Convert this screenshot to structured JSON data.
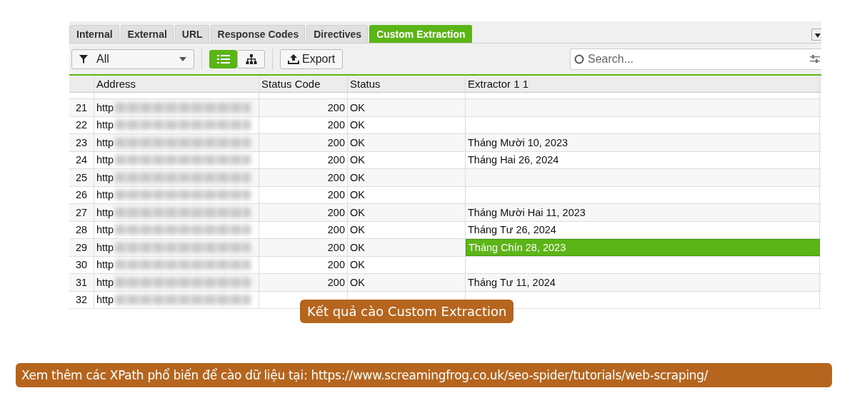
{
  "tabs": [
    {
      "label": "Internal",
      "selected": false
    },
    {
      "label": "External",
      "selected": false
    },
    {
      "label": "URL",
      "selected": false
    },
    {
      "label": "Response Codes",
      "selected": false
    },
    {
      "label": "Directives",
      "selected": false
    },
    {
      "label": "Custom Extraction",
      "selected": true
    }
  ],
  "filter": {
    "value": "All"
  },
  "view_toggle": [
    {
      "kind": "list",
      "selected": true
    },
    {
      "kind": "tree",
      "selected": false
    }
  ],
  "export_button": "Export",
  "search": {
    "placeholder": "Search..."
  },
  "table": {
    "columns": [
      "Address",
      "Status Code",
      "Status",
      "Extractor 1 1"
    ],
    "rows": [
      {
        "index": "21",
        "address": "http",
        "status_code": "200",
        "status": "OK",
        "extractor": "",
        "selected": false
      },
      {
        "index": "22",
        "address": "http",
        "status_code": "200",
        "status": "OK",
        "extractor": "",
        "selected": false
      },
      {
        "index": "23",
        "address": "http",
        "status_code": "200",
        "status": "OK",
        "extractor": "Tháng Mười 10, 2023",
        "selected": false
      },
      {
        "index": "24",
        "address": "http",
        "status_code": "200",
        "status": "OK",
        "extractor": "Tháng Hai 26, 2024",
        "selected": false
      },
      {
        "index": "25",
        "address": "http",
        "status_code": "200",
        "status": "OK",
        "extractor": "",
        "selected": false
      },
      {
        "index": "26",
        "address": "http",
        "status_code": "200",
        "status": "OK",
        "extractor": "",
        "selected": false
      },
      {
        "index": "27",
        "address": "http",
        "status_code": "200",
        "status": "OK",
        "extractor": "Tháng Mười Hai 11, 2023",
        "selected": false
      },
      {
        "index": "28",
        "address": "http",
        "status_code": "200",
        "status": "OK",
        "extractor": "Tháng Tư 26, 2024",
        "selected": false
      },
      {
        "index": "29",
        "address": "http",
        "status_code": "200",
        "status": "OK",
        "extractor": "Tháng Chín 28, 2023",
        "selected": true
      },
      {
        "index": "30",
        "address": "http",
        "status_code": "200",
        "status": "OK",
        "extractor": "",
        "selected": false
      },
      {
        "index": "31",
        "address": "http",
        "status_code": "200",
        "status": "OK",
        "extractor": "Tháng Tư 11, 2024",
        "selected": false
      },
      {
        "index": "32",
        "address": "http",
        "status_code": "",
        "status": "",
        "extractor": "",
        "selected": false
      }
    ]
  },
  "image_caption": "Kết quả cào Custom Extraction",
  "footer_note": "Xem thêm các XPath phổ biến để cào dữ liệu tại: https://www.screamingfrog.co.uk/seo-spider/tutorials/web-scraping/"
}
